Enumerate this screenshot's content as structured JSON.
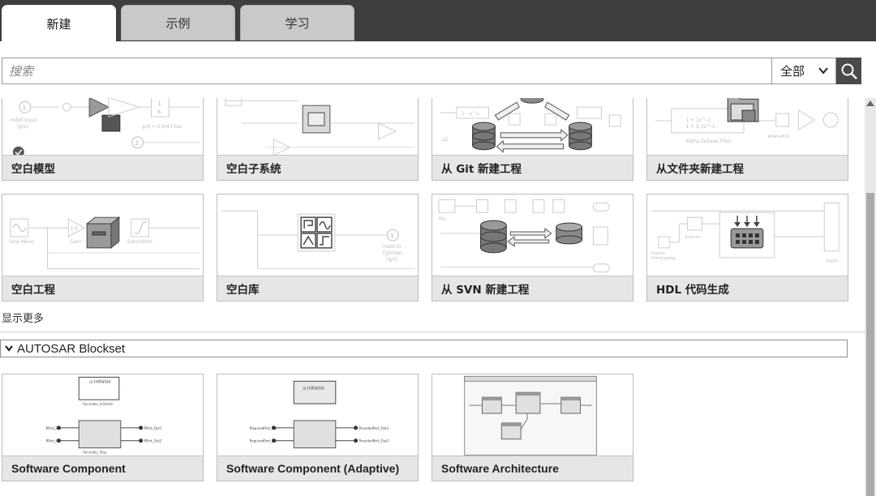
{
  "tabs": [
    {
      "label": "新建",
      "active": true
    },
    {
      "label": "示例",
      "active": false
    },
    {
      "label": "学习",
      "active": false
    }
  ],
  "search": {
    "placeholder": "搜索",
    "scope": "全部"
  },
  "templates": [
    {
      "label": "空白模型",
      "checked": true
    },
    {
      "label": "空白子系统"
    },
    {
      "label": "从 Git 新建工程"
    },
    {
      "label": "从文件夹新建工程"
    },
    {
      "label": "空白工程"
    },
    {
      "label": "空白库"
    },
    {
      "label": "从 SVN 新建工程"
    },
    {
      "label": "HDL 代码生成"
    }
  ],
  "show_more": "显示更多",
  "autosar": {
    "title": "AUTOSAR Blockset",
    "cards": [
      {
        "label": "Software Component"
      },
      {
        "label": "Software Component (Adaptive)"
      },
      {
        "label": "Software Architecture"
      }
    ]
  },
  "colors": {
    "tabbar_bg": "#3e3e3e",
    "card_label_bg": "#e6e6e6",
    "search_button_bg": "#4a4a4a"
  }
}
